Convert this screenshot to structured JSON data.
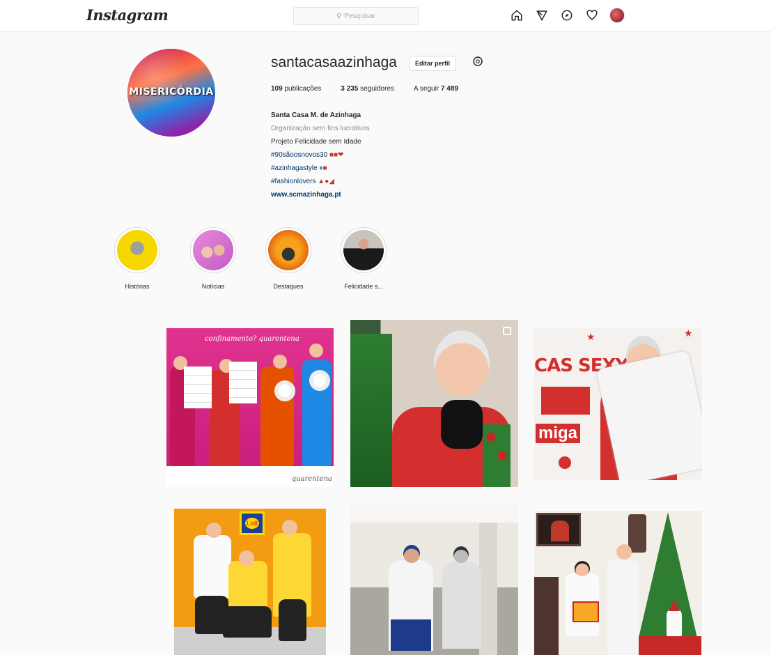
{
  "header": {
    "logo": "Instagram",
    "search_placeholder": "Pesquisar",
    "search_icon": "search-icon"
  },
  "profile": {
    "username": "santacasaazinhaga",
    "edit_button": "Editar perfil",
    "picture_text": "MISERICÓRDIA",
    "stats": {
      "posts_count": "109",
      "posts_label": "publicações",
      "followers_count": "3 235",
      "followers_label": "seguidores",
      "following_label": "A seguir",
      "following_count": "7 489"
    },
    "bio": {
      "name": "Santa Casa M. de Azinhaga",
      "category": "Organização sem fins lucrativos",
      "line1": "Projeto Felicidade sem Idade",
      "tag1": "#90sãoosnovos30",
      "tag2": "#azinhagastyle",
      "tag3": "#fashionlovers",
      "website": "www.scmazinhaga.pt"
    }
  },
  "highlights": [
    {
      "label": "Histórias"
    },
    {
      "label": "Notícias"
    },
    {
      "label": "Destaques"
    },
    {
      "label": "Felicidade s..."
    }
  ],
  "posts": {
    "post1_text": "confinamento? quarentena",
    "post1_signature": "quarentena",
    "post3_text1": "CAS SEXY",
    "post3_text2": "miga",
    "post4_text": "Lidl"
  },
  "colors": {
    "accent_link": "#00376b",
    "border": "#dbdbdb"
  }
}
